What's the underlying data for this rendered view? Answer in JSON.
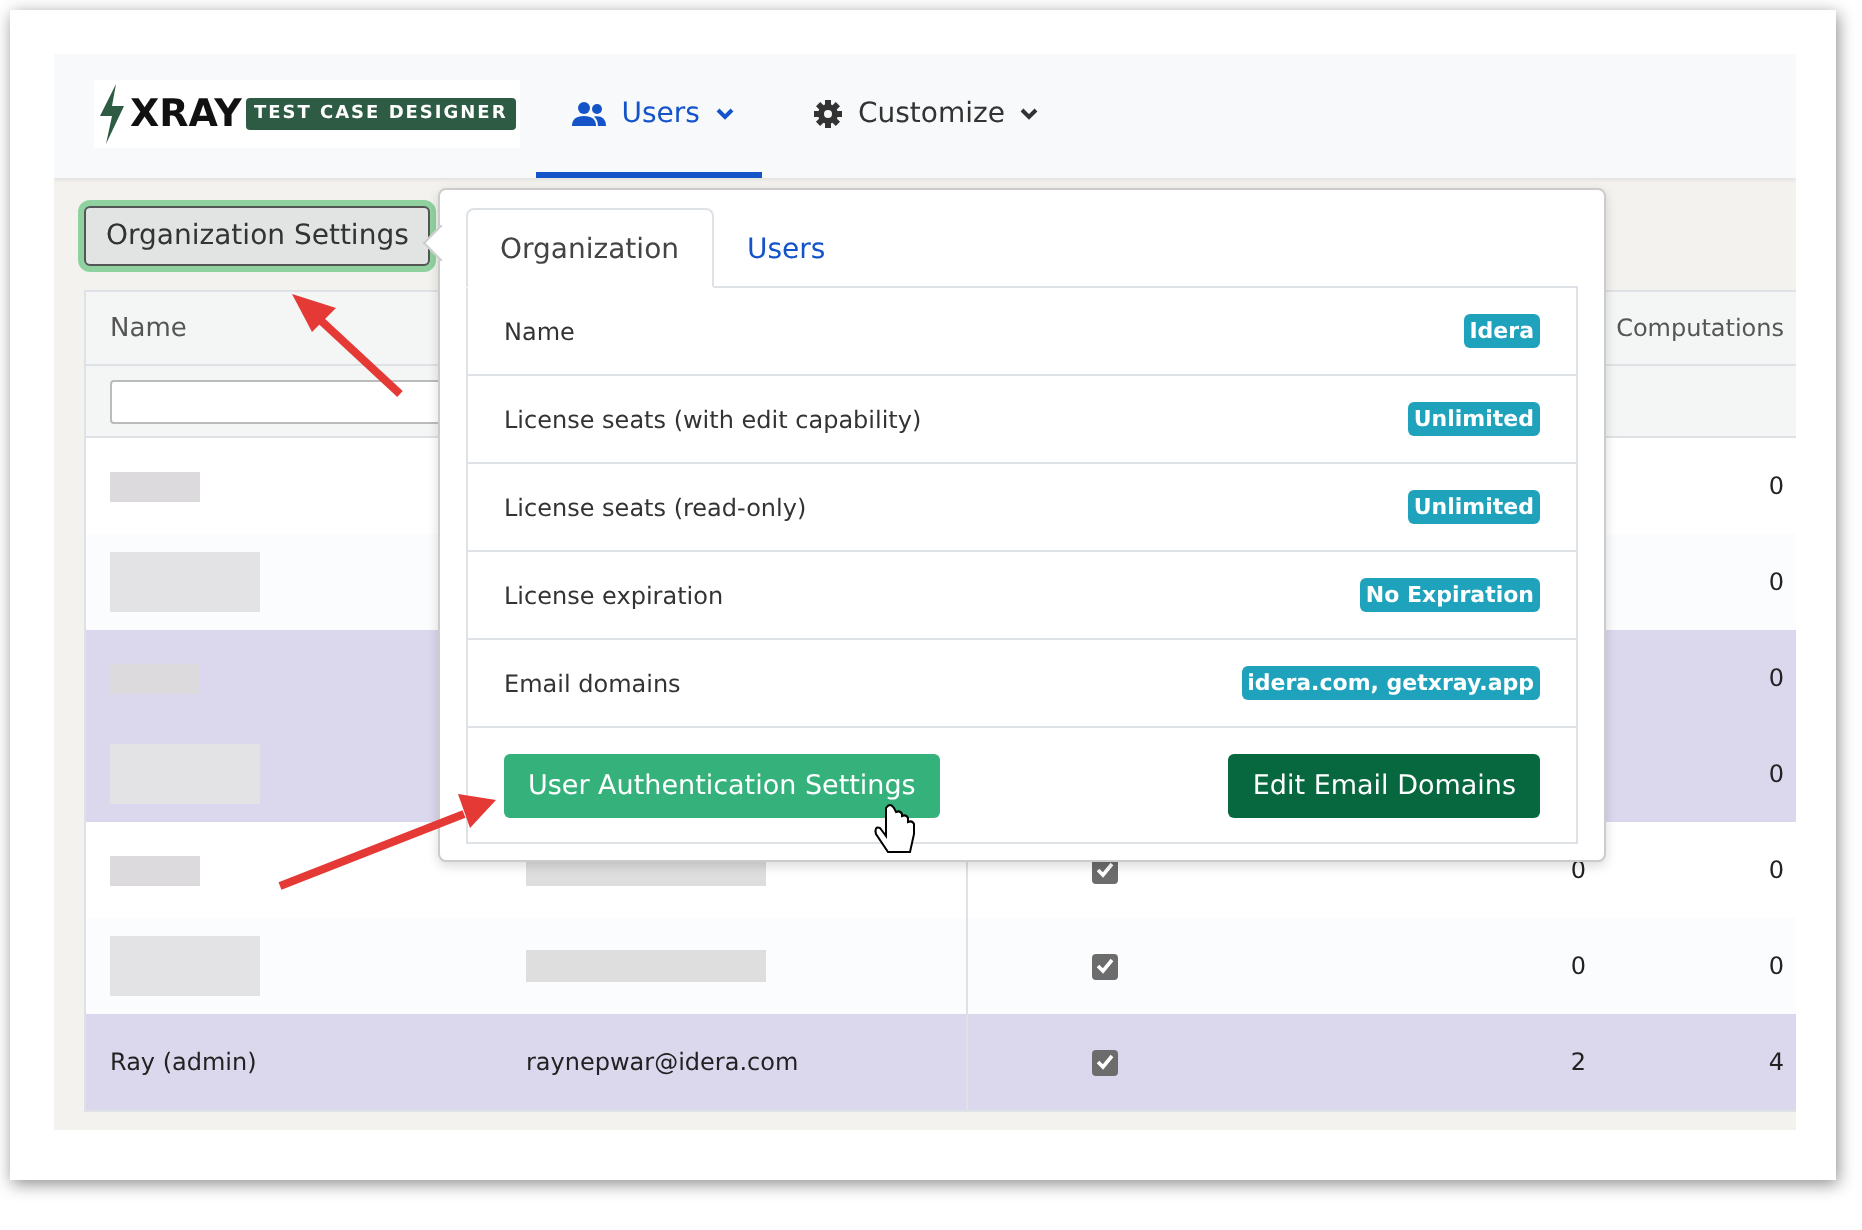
{
  "logo": {
    "brand": "XRAY",
    "product": "TEST CASE DESIGNER"
  },
  "nav": [
    {
      "label": "Users",
      "selected": true
    },
    {
      "label": "Customize",
      "selected": false
    }
  ],
  "settings_button": {
    "label": "Organization Settings"
  },
  "table": {
    "name_header": "Name",
    "computations_header": "Computations",
    "rows": [
      {
        "selected": false,
        "name": null,
        "email": null,
        "checked": null,
        "column_4": null,
        "computations": "0"
      },
      {
        "selected": false,
        "name": null,
        "email": null,
        "checked": null,
        "column_4": null,
        "computations": "0"
      },
      {
        "selected": true,
        "name": null,
        "email": null,
        "checked": null,
        "column_4": null,
        "computations": "0"
      },
      {
        "selected": true,
        "name": null,
        "email": null,
        "checked": null,
        "column_4": null,
        "computations": "0"
      },
      {
        "selected": false,
        "name": null,
        "email": null,
        "checked": true,
        "column_4": "0",
        "computations": "0"
      },
      {
        "selected": false,
        "name": null,
        "email": null,
        "checked": true,
        "column_4": "0",
        "computations": "0"
      },
      {
        "selected": true,
        "name": "Ray (admin)",
        "email": "raynepwar@idera.com",
        "checked": true,
        "column_4": "2",
        "computations": "4"
      }
    ]
  },
  "popover": {
    "tabs": [
      {
        "label": "Organization",
        "selected": true
      },
      {
        "label": "Users",
        "selected": false
      }
    ],
    "fields": [
      {
        "label": "Name",
        "value": "Idera"
      },
      {
        "label": "License seats (with edit capability)",
        "value": "Unlimited"
      },
      {
        "label": "License seats (read-only)",
        "value": "Unlimited"
      },
      {
        "label": "License expiration",
        "value": "No Expiration"
      },
      {
        "label": "Email domains",
        "value": "idera.com, getxray.app"
      }
    ],
    "buttons": [
      {
        "label": "User Authentication Settings",
        "kind": "light"
      },
      {
        "label": "Edit Email Domains",
        "kind": "dark"
      }
    ]
  }
}
